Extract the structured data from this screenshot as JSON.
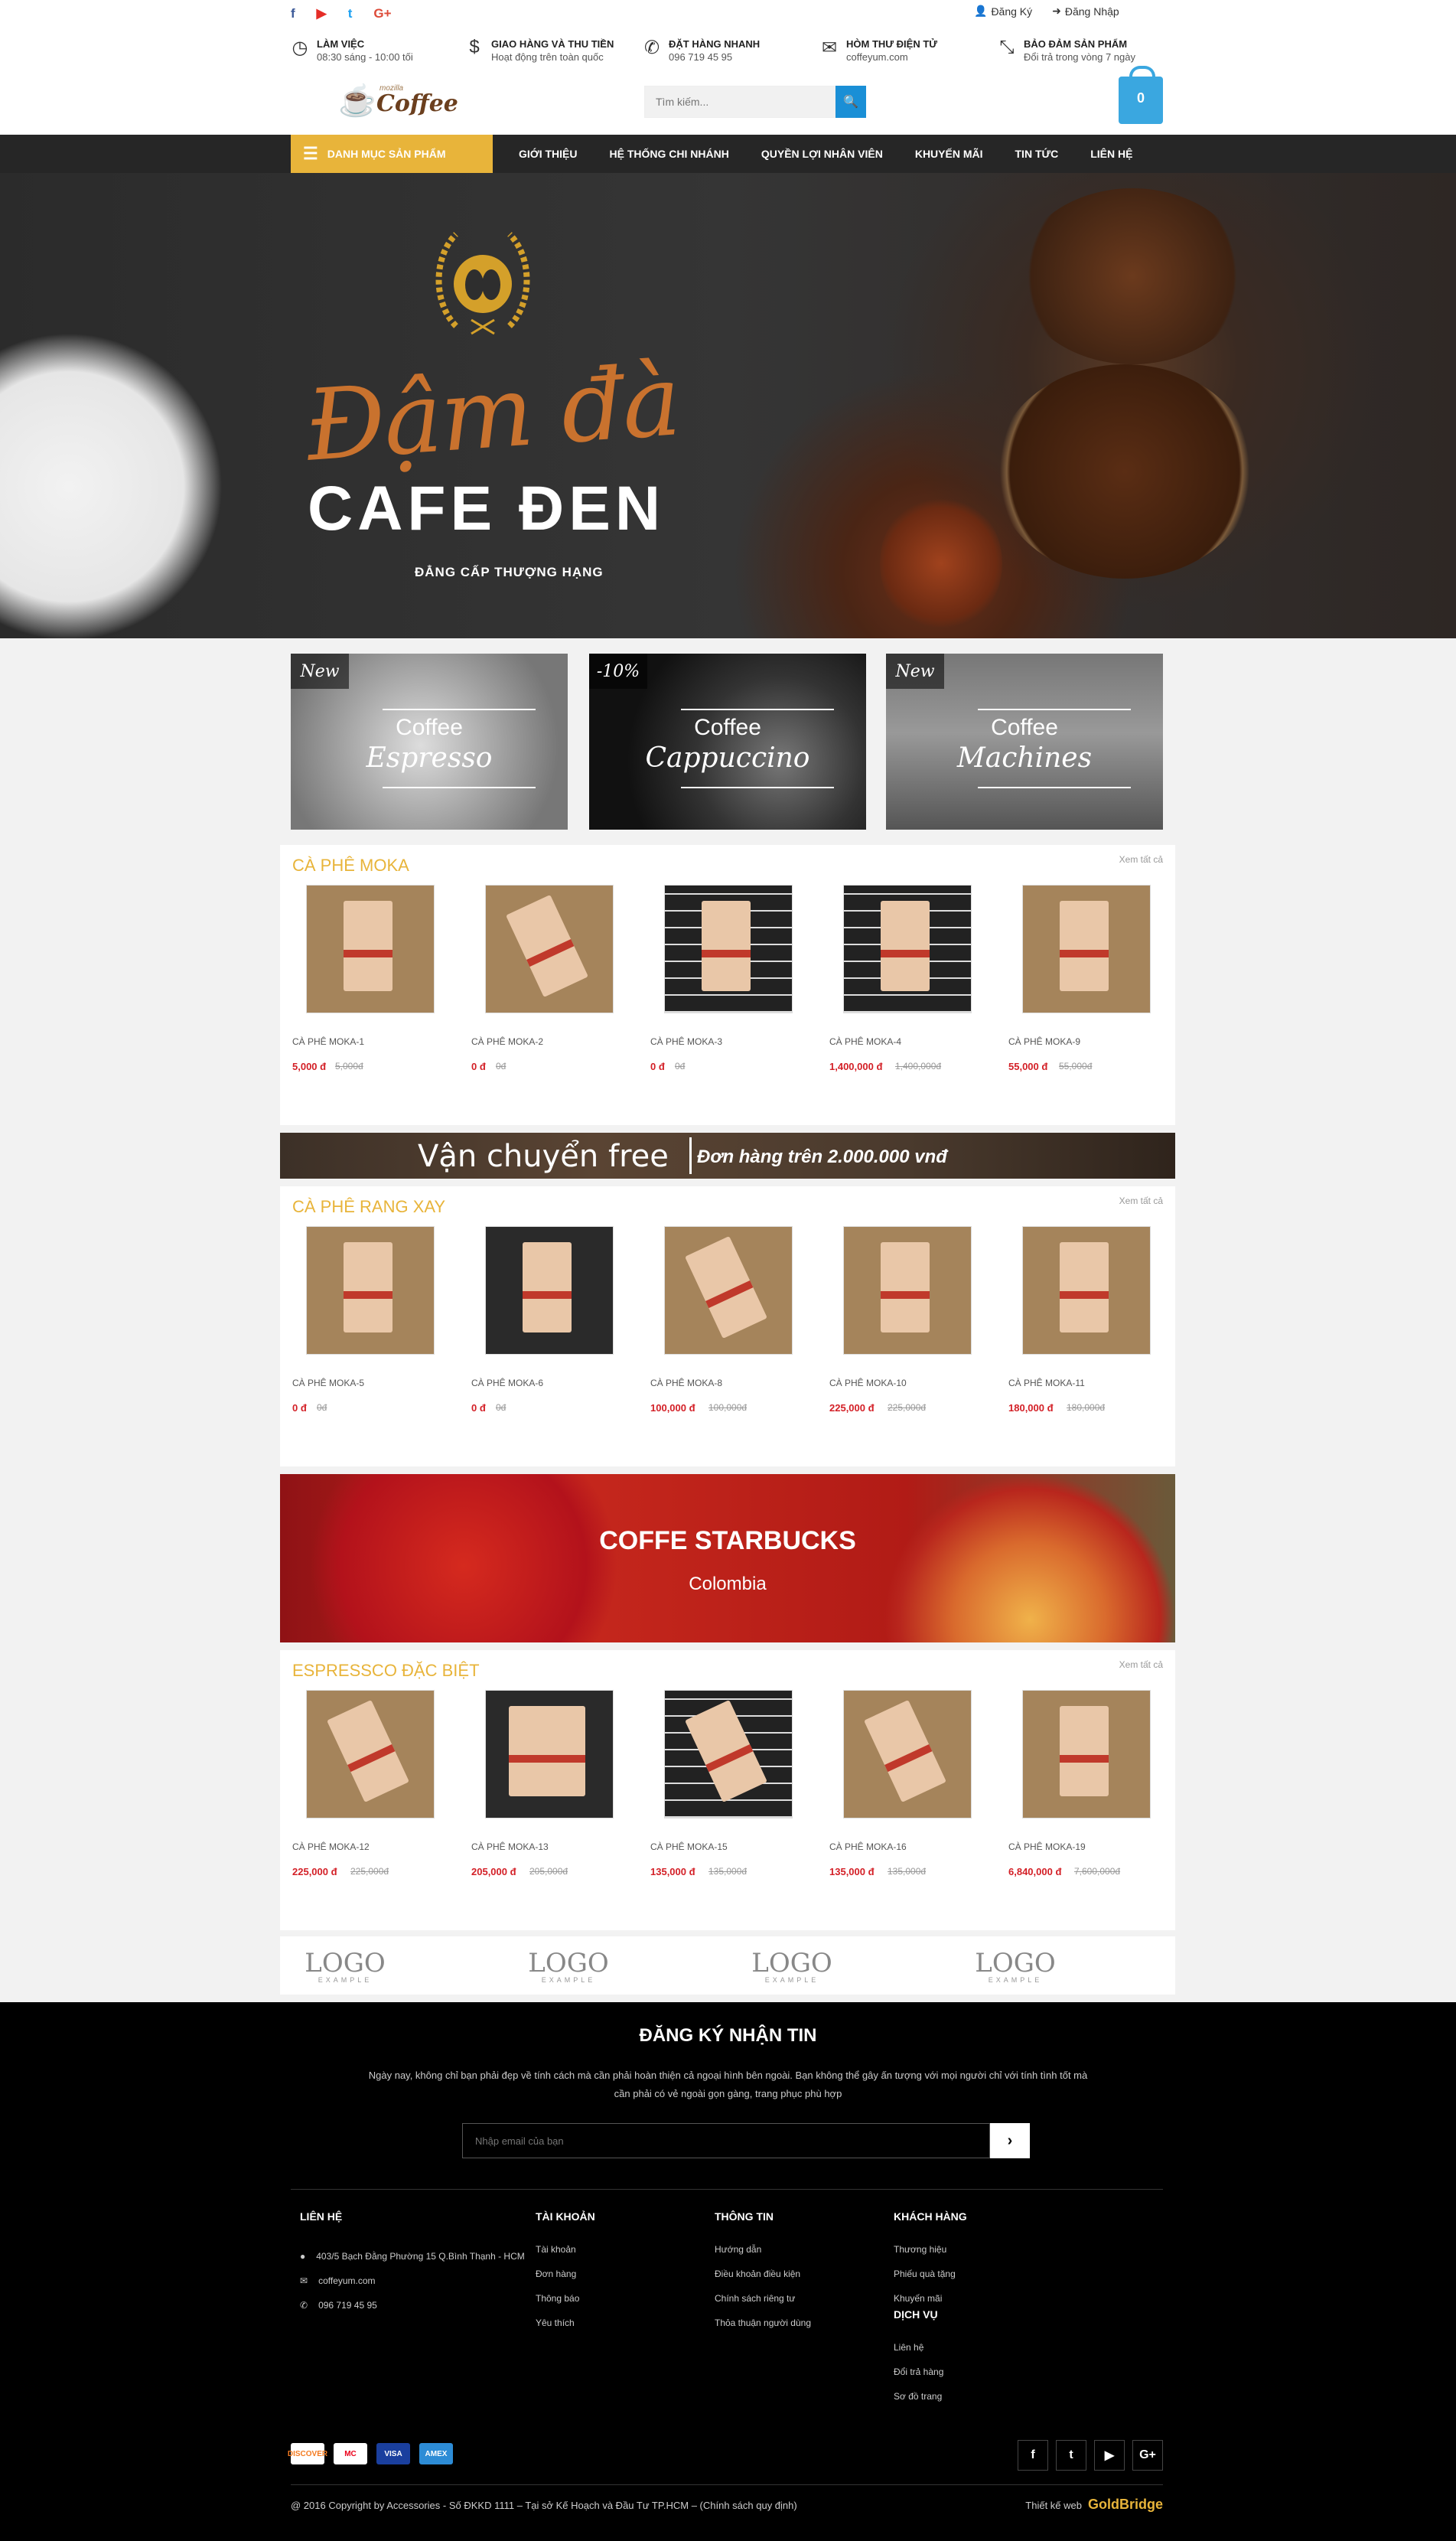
{
  "header": {
    "social_icons": [
      "facebook-icon",
      "youtube-icon",
      "twitter-icon",
      "google-plus-icon"
    ],
    "social_labels": {
      "facebook": "f",
      "youtube": "▶",
      "twitter": "t",
      "google": "G+"
    },
    "register": "Đăng Ký",
    "login": "Đăng Nhập",
    "info": [
      {
        "title": "LÀM VIỆC",
        "text": "08:30 sáng - 10:00 tối",
        "icon": "clock-icon"
      },
      {
        "title": "GIAO HÀNG VÀ THU TIỀN",
        "text": "Hoạt động trên toàn quốc",
        "icon": "dollar-icon"
      },
      {
        "title": "ĐẶT HÀNG NHANH",
        "text": "096 719 45 95",
        "icon": "phone-icon"
      },
      {
        "title": "HÒM THƯ ĐIỆN TỬ",
        "text": "coffeyum.com",
        "icon": "mail-icon"
      },
      {
        "title": "BẢO ĐẢM SẢN PHẨM",
        "text": "Đổi trả trong vòng 7 ngày",
        "icon": "compress-icon"
      }
    ],
    "logo_sub": "mozilla",
    "logo_name": "Coffee",
    "search_placeholder": "Tìm kiếm...",
    "cart_count": "0"
  },
  "nav": {
    "category": "DANH MỤC SẢN PHẨM",
    "items": [
      "GIỚI THIỆU",
      "HỆ THỐNG CHI NHÁNH",
      "QUYỀN LỢI NHÂN VIÊN",
      "KHUYẾN MÃI",
      "TIN TỨC",
      "LIÊN HỆ"
    ]
  },
  "hero": {
    "script": "Đậm đà",
    "title": "CAFE ĐEN",
    "subtitle": "ĐẲNG CẤP THƯỢNG HẠNG"
  },
  "promos": [
    {
      "tag": "New",
      "line1": "Coffee",
      "line2": "Espresso"
    },
    {
      "tag": "-10%",
      "line1": "Coffee",
      "line2": "Cappuccino"
    },
    {
      "tag": "New",
      "line1": "Coffee",
      "line2": "Machines"
    }
  ],
  "see_all": "Xem tất cả",
  "sections": [
    {
      "title": "CÀ PHÊ MOKA",
      "products": [
        {
          "name": "CÀ PHÊ MOKA-1",
          "price": "5,000 đ",
          "old": "5,000đ"
        },
        {
          "name": "CÀ PHÊ MOKA-2",
          "price": "0 đ",
          "old": "0đ"
        },
        {
          "name": "CÀ PHÊ MOKA-3",
          "price": "0 đ",
          "old": "0đ"
        },
        {
          "name": "CÀ PHÊ MOKA-4",
          "price": "1,400,000 đ",
          "old": "1,400,000đ"
        },
        {
          "name": "CÀ PHÊ MOKA-9",
          "price": "55,000 đ",
          "old": "55,000đ"
        }
      ]
    },
    {
      "title": "CÀ PHÊ RANG XAY",
      "products": [
        {
          "name": "CÀ PHÊ MOKA-5",
          "price": "0 đ",
          "old": "0đ"
        },
        {
          "name": "CÀ PHÊ MOKA-6",
          "price": "0 đ",
          "old": "0đ"
        },
        {
          "name": "CÀ PHÊ MOKA-8",
          "price": "100,000 đ",
          "old": "100,000đ"
        },
        {
          "name": "CÀ PHÊ MOKA-10",
          "price": "225,000 đ",
          "old": "225,000đ"
        },
        {
          "name": "CÀ PHÊ MOKA-11",
          "price": "180,000 đ",
          "old": "180,000đ"
        }
      ]
    },
    {
      "title": "ESPRESSCO ĐẶC BIỆT",
      "products": [
        {
          "name": "CÀ PHÊ MOKA-12",
          "price": "225,000 đ",
          "old": "225,000đ"
        },
        {
          "name": "CÀ PHÊ MOKA-13",
          "price": "205,000 đ",
          "old": "205,000đ"
        },
        {
          "name": "CÀ PHÊ MOKA-15",
          "price": "135,000 đ",
          "old": "135,000đ"
        },
        {
          "name": "CÀ PHÊ MOKA-16",
          "price": "135,000 đ",
          "old": "135,000đ"
        },
        {
          "name": "CÀ PHÊ MOKA-19",
          "price": "6,840,000 đ",
          "old": "7,600,000đ"
        }
      ]
    }
  ],
  "shipping": {
    "left": "Vận chuyển free",
    "right": "Đơn hàng trên 2.000.000 vnđ"
  },
  "starbucks": {
    "title": "COFFE STARBUCKS",
    "subtitle": "Colombia"
  },
  "brands": [
    {
      "logo": "LOGO",
      "example": "EXAMPLE"
    },
    {
      "logo": "LOGO",
      "example": "EXAMPLE"
    },
    {
      "logo": "LOGO",
      "example": "EXAMPLE"
    },
    {
      "logo": "LOGO",
      "example": "EXAMPLE"
    }
  ],
  "footer": {
    "newsletter_title": "ĐĂNG KÝ NHẬN TIN",
    "newsletter_desc": "Ngày nay, không chỉ bạn phải đẹp về tính cách mà cần phải hoàn thiện cả ngoại hình bên ngoài. Bạn không thể gây ấn tượng với mọi người chỉ với tính tình tốt mà cần phải có vẻ ngoài gọn gàng, trang phục phù hợp",
    "email_placeholder": "Nhập email của bạn",
    "contact_title": "LIÊN HỆ",
    "contact": [
      {
        "icon": "map-marker-icon",
        "text": "403/5 Bạch Đằng Phường 15 Q.Bình Thạnh - HCM"
      },
      {
        "icon": "mail-icon",
        "text": "coffeyum.com"
      },
      {
        "icon": "phone-icon",
        "text": "096 719 45 95"
      }
    ],
    "account_title": "TÀI KHOẢN",
    "account": [
      "Tài khoản",
      "Đơn hàng",
      "Thông báo",
      "Yêu thích"
    ],
    "info_title": "THÔNG TIN",
    "info": [
      "Hướng dẫn",
      "Điều khoản điều kiện",
      "Chính sách riêng tư",
      "Thỏa thuận người dùng"
    ],
    "customer_title": "KHÁCH HÀNG",
    "customer": [
      "Thương hiệu",
      "Phiếu quà tặng",
      "Khuyến mãi"
    ],
    "service_title": "DỊCH VỤ",
    "service": [
      "Liên hệ",
      "Đổi trả hàng",
      "Sơ đồ trang"
    ],
    "payments": [
      "DISCOVER",
      "MC",
      "VISA",
      "AMEX"
    ],
    "social": [
      "f",
      "t",
      "▶",
      "G+"
    ],
    "copyright": "@ 2016 Copyright by Accessories - Số ĐKKD 1111 – Tại sở Kế Hoạch và Đầu Tư TP.HCM – (Chính sách quy định)",
    "design_label": "Thiết kế web",
    "design_brand": "GoldBridge"
  }
}
